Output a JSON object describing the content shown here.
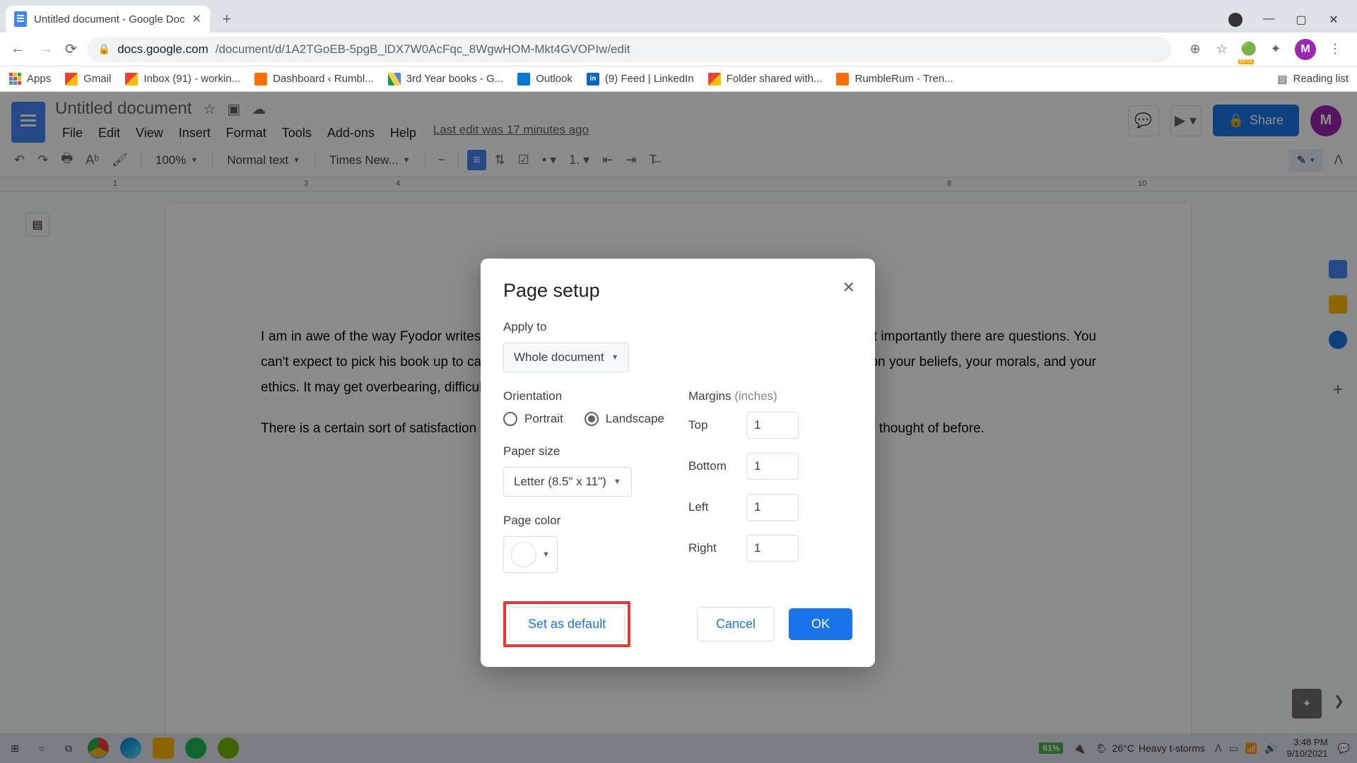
{
  "browser": {
    "tab_title": "Untitled document - Google Doc",
    "url_domain": "docs.google.com",
    "url_path": "/document/d/1A2TGoEB-5pgB_lDX7W0AcFqc_8WgwHOM-Mkt4GVOPIw/edit",
    "profile_initial": "M"
  },
  "bookmarks": {
    "apps": "Apps",
    "items": [
      "Gmail",
      "Inbox (91) - workin...",
      "Dashboard ‹ Rumbl...",
      "3rd Year books - G...",
      "Outlook",
      "(9) Feed | LinkedIn",
      "Folder shared with...",
      "RumbleRum - Tren..."
    ],
    "reading_list": "Reading list"
  },
  "docs": {
    "title": "Untitled document",
    "menus": [
      "File",
      "Edit",
      "View",
      "Insert",
      "Format",
      "Tools",
      "Add-ons",
      "Help"
    ],
    "last_edit": "Last edit was 17 minutes ago",
    "share": "Share",
    "zoom": "100%",
    "style": "Normal text",
    "font": "Times New...",
    "para1": "I am in awe of the way Fyodor writes. There is suspense, drama, struggle, mysticism, religion and most importantly there are questions. You can't expect to pick his book up to calm yourself down, no. His books will spite you, force you to question your beliefs, your morals, and your ethics. It may get overbearing, difficult at times but the excitement is always in the end.",
    "para2": "There is a certain sort of satisfaction after finishing his books as if you learnt something you hadn't even thought of before."
  },
  "dialog": {
    "title": "Page setup",
    "apply_to_label": "Apply to",
    "apply_to_value": "Whole document",
    "orientation_label": "Orientation",
    "portrait": "Portrait",
    "landscape": "Landscape",
    "paper_size_label": "Paper size",
    "paper_size_value": "Letter (8.5\" x 11\")",
    "page_color_label": "Page color",
    "margins_label": "Margins",
    "margins_unit": "(inches)",
    "top": "Top",
    "top_val": "1",
    "bottom": "Bottom",
    "bottom_val": "1",
    "left": "Left",
    "left_val": "1",
    "right": "Right",
    "right_val": "1",
    "set_default": "Set as default",
    "cancel": "Cancel",
    "ok": "OK"
  },
  "taskbar": {
    "battery": "61%",
    "temp": "26°C",
    "weather": "Heavy t-storms",
    "time": "3:48 PM",
    "date": "9/10/2021"
  }
}
